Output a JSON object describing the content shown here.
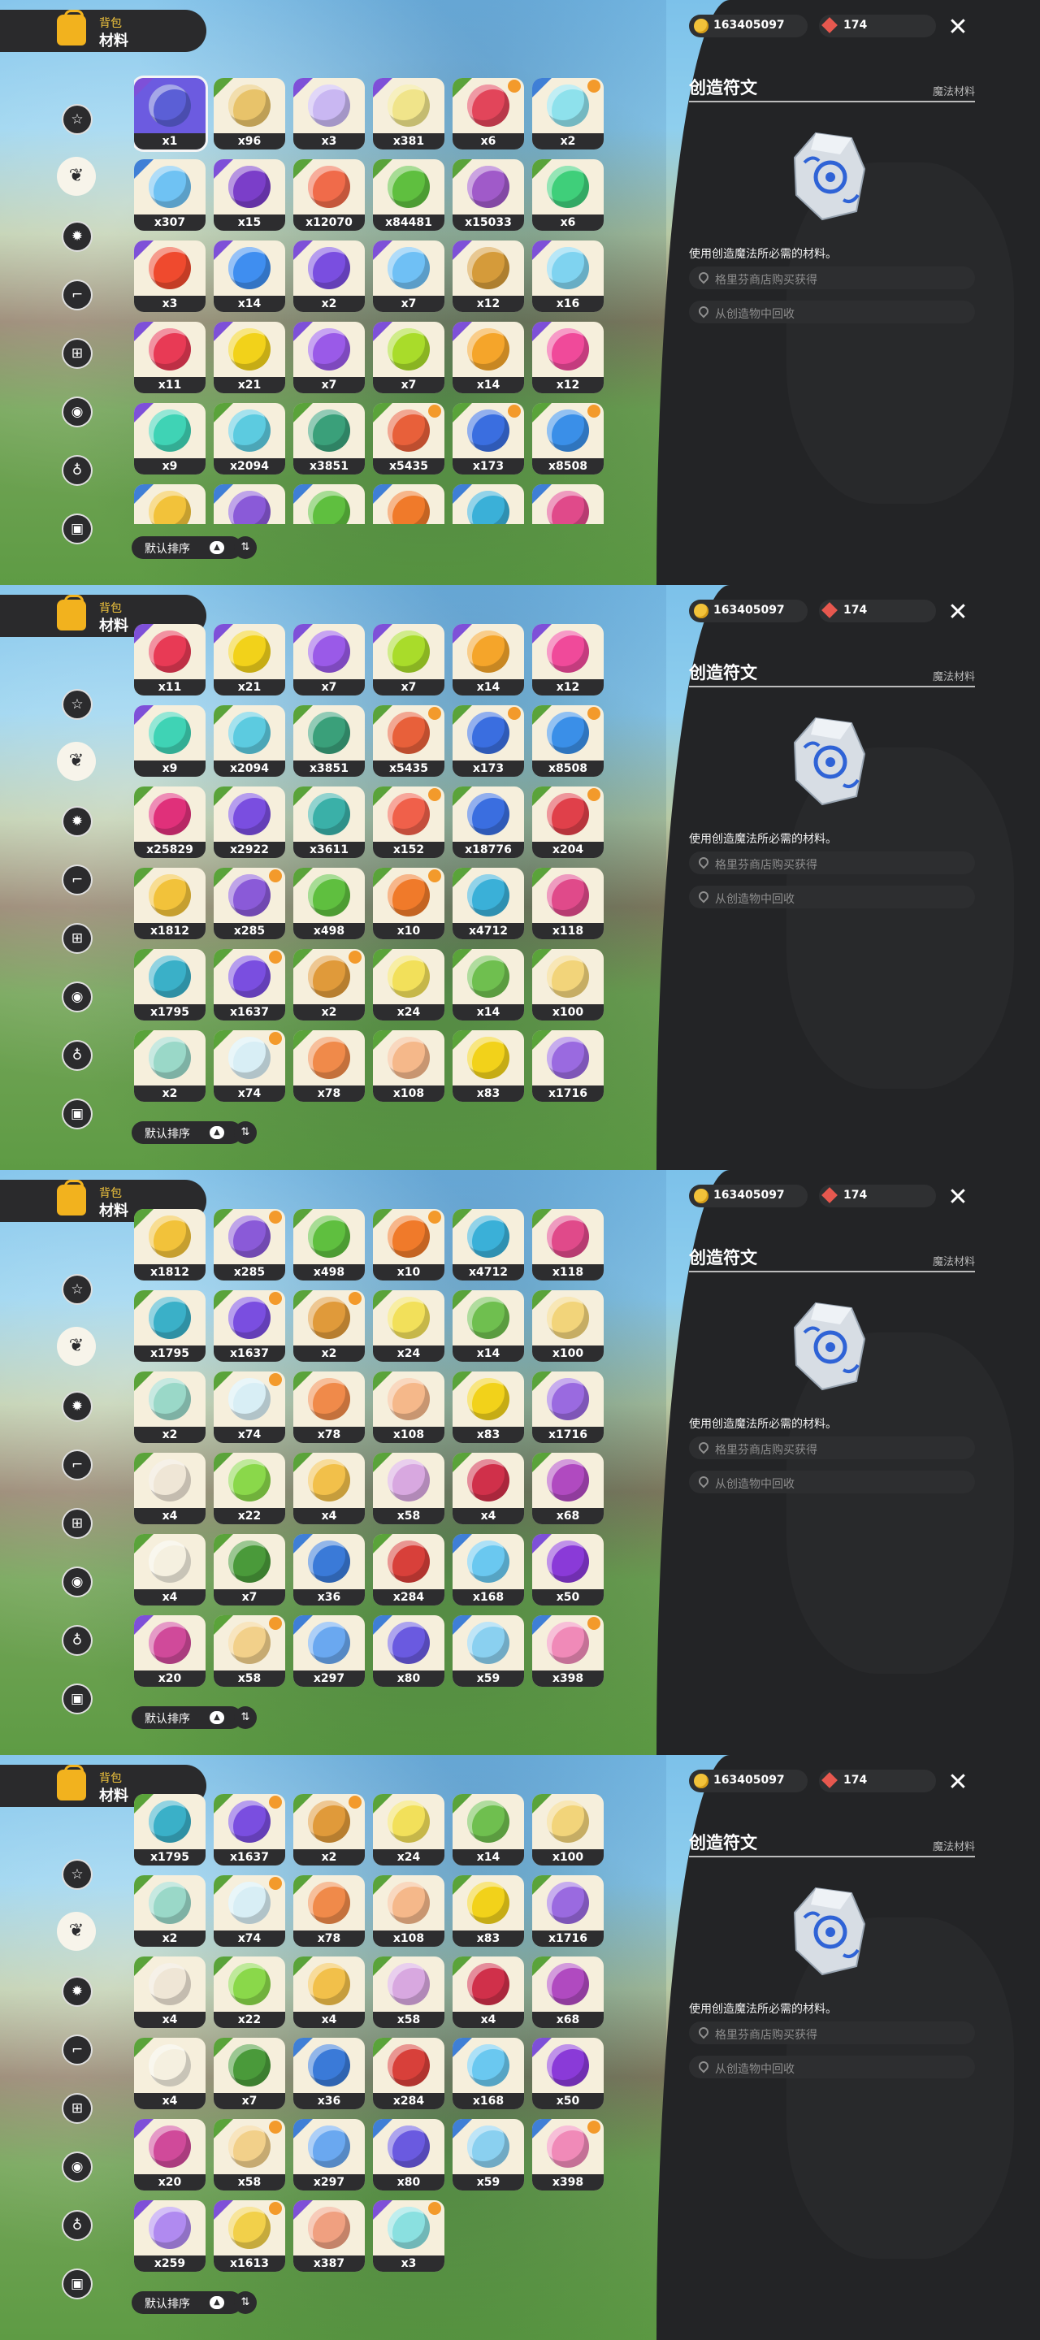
{
  "header": {
    "title_top": "背包",
    "title": "材料"
  },
  "currency": {
    "coins": "163405097",
    "gems": "174"
  },
  "sort": {
    "label": "默认排序"
  },
  "detail": {
    "item_name": "创造符文",
    "category": "魔法材料",
    "description": "使用创造魔法所必需的材料。",
    "sources": [
      "格里芬商店购买获得",
      "从创造物中回收"
    ]
  },
  "colors": {
    "accent": "#f2b21e",
    "panel_bg": "#232426",
    "rarity_purple": "#7e50d8",
    "rarity_green": "#5aa33a",
    "rarity_blue": "#3f7fd6"
  },
  "categories": [
    {
      "icon": "star-icon",
      "glyph": "☆"
    },
    {
      "icon": "leaf-icon",
      "glyph": "❦"
    },
    {
      "icon": "gear-icon",
      "glyph": "✹"
    },
    {
      "icon": "boot-icon",
      "glyph": "⌐"
    },
    {
      "icon": "cart-icon",
      "glyph": "⊞"
    },
    {
      "icon": "ball-icon",
      "glyph": "◉"
    },
    {
      "icon": "bell-icon",
      "glyph": "♁"
    },
    {
      "icon": "chest-icon",
      "glyph": "▣"
    }
  ],
  "views": [
    {
      "selected_category": 1,
      "rows": [
        [
          [
            "x1",
            "#5b5fd6",
            "p",
            0
          ],
          [
            "x96",
            "#e8c36a",
            "g",
            0
          ],
          [
            "x3",
            "#c9b7f2",
            "p",
            0
          ],
          [
            "x381",
            "#f0e48a",
            "p",
            0
          ],
          [
            "x6",
            "#e2455a",
            "g",
            1
          ],
          [
            "x2",
            "#8ee1ec",
            "b",
            1
          ]
        ],
        [
          [
            "x307",
            "#6fc2f3",
            "b",
            0
          ],
          [
            "x15",
            "#7b3ec9",
            "p",
            0
          ],
          [
            "x12070",
            "#f06b4a",
            "g",
            0
          ],
          [
            "x84481",
            "#5fbf3f",
            "g",
            0
          ],
          [
            "x15033",
            "#a05ac9",
            "g",
            0
          ],
          [
            "x6",
            "#3fcf7a",
            "g",
            0
          ]
        ],
        [
          [
            "x3",
            "#ef4a2e",
            "p",
            0
          ],
          [
            "x14",
            "#3f8ef0",
            "p",
            0
          ],
          [
            "x2",
            "#7a4ee0",
            "p",
            0
          ],
          [
            "x7",
            "#6fc0f5",
            "p",
            0
          ],
          [
            "x12",
            "#d59b3a",
            "p",
            0
          ],
          [
            "x16",
            "#7fd3f0",
            "p",
            0
          ]
        ],
        [
          [
            "x11",
            "#e83a55",
            "p",
            0
          ],
          [
            "x21",
            "#f2d21a",
            "p",
            0
          ],
          [
            "x7",
            "#9a5ae8",
            "p",
            0
          ],
          [
            "x7",
            "#a9dc2a",
            "p",
            0
          ],
          [
            "x14",
            "#f5a52a",
            "p",
            0
          ],
          [
            "x12",
            "#f04a9a",
            "p",
            0
          ]
        ],
        [
          [
            "x9",
            "#3fd3b5",
            "p",
            0
          ],
          [
            "x2094",
            "#5ccbe0",
            "g",
            0
          ],
          [
            "x3851",
            "#3aa07a",
            "g",
            0
          ],
          [
            "x5435",
            "#e8603a",
            "g",
            1
          ],
          [
            "x173",
            "#3a6ee0",
            "g",
            1
          ],
          [
            "x8508",
            "#3a8fe8",
            "g",
            1
          ]
        ],
        [
          [
            "",
            "#f2c23a",
            "b",
            0
          ],
          [
            "",
            "#8a5ad8",
            "b",
            0
          ],
          [
            "",
            "#5fbf3f",
            "b",
            0
          ],
          [
            "",
            "#f07a2a",
            "b",
            0
          ],
          [
            "",
            "#3ab0d8",
            "b",
            0
          ],
          [
            "",
            "#e04a8a",
            "b",
            0
          ]
        ]
      ]
    },
    {
      "selected_category": 1,
      "rows": [
        [
          [
            "x11",
            "#e83a55",
            "p",
            0
          ],
          [
            "x21",
            "#f2d21a",
            "p",
            0
          ],
          [
            "x7",
            "#9a5ae8",
            "p",
            0
          ],
          [
            "x7",
            "#a9dc2a",
            "p",
            0
          ],
          [
            "x14",
            "#f5a52a",
            "p",
            0
          ],
          [
            "x12",
            "#f04a9a",
            "p",
            0
          ]
        ],
        [
          [
            "x9",
            "#3fd3b5",
            "p",
            0
          ],
          [
            "x2094",
            "#5ccbe0",
            "g",
            0
          ],
          [
            "x3851",
            "#3aa07a",
            "g",
            0
          ],
          [
            "x5435",
            "#e8603a",
            "g",
            1
          ],
          [
            "x173",
            "#3a6ee0",
            "g",
            1
          ],
          [
            "x8508",
            "#3a8fe8",
            "g",
            1
          ]
        ],
        [
          [
            "x25829",
            "#e0307a",
            "g",
            0
          ],
          [
            "x2922",
            "#7a4ee0",
            "g",
            0
          ],
          [
            "x3611",
            "#3ab0a8",
            "g",
            0
          ],
          [
            "x152",
            "#f0604a",
            "g",
            1
          ],
          [
            "x18776",
            "#3a6ee0",
            "g",
            0
          ],
          [
            "x204",
            "#e0404a",
            "g",
            1
          ]
        ],
        [
          [
            "x1812",
            "#f2c23a",
            "g",
            0
          ],
          [
            "x285",
            "#8a5ad8",
            "g",
            1
          ],
          [
            "x498",
            "#5fbf3f",
            "g",
            0
          ],
          [
            "x10",
            "#f07a2a",
            "g",
            1
          ],
          [
            "x4712",
            "#3ab0d8",
            "g",
            0
          ],
          [
            "x118",
            "#e04a8a",
            "g",
            0
          ]
        ],
        [
          [
            "x1795",
            "#3ab0c8",
            "g",
            0
          ],
          [
            "x1637",
            "#7a4ee0",
            "g",
            1
          ],
          [
            "x2",
            "#e09a3a",
            "g",
            1
          ],
          [
            "x24",
            "#f2e05a",
            "g",
            0
          ],
          [
            "x14",
            "#6fbf4f",
            "g",
            0
          ],
          [
            "x100",
            "#f2d47a",
            "g",
            0
          ]
        ],
        [
          [
            "x2",
            "#9ad8c8",
            "g",
            0
          ],
          [
            "x74",
            "#d8eef5",
            "g",
            1
          ],
          [
            "x78",
            "#f08a4a",
            "g",
            0
          ],
          [
            "x108",
            "#f5b88a",
            "g",
            0
          ],
          [
            "x83",
            "#f2d21a",
            "g",
            0
          ],
          [
            "x1716",
            "#9a6ae0",
            "g",
            0
          ]
        ]
      ]
    },
    {
      "selected_category": 1,
      "rows": [
        [
          [
            "x1812",
            "#f2c23a",
            "g",
            0
          ],
          [
            "x285",
            "#8a5ad8",
            "g",
            1
          ],
          [
            "x498",
            "#5fbf3f",
            "g",
            0
          ],
          [
            "x10",
            "#f07a2a",
            "g",
            1
          ],
          [
            "x4712",
            "#3ab0d8",
            "g",
            0
          ],
          [
            "x118",
            "#e04a8a",
            "g",
            0
          ]
        ],
        [
          [
            "x1795",
            "#3ab0c8",
            "g",
            0
          ],
          [
            "x1637",
            "#7a4ee0",
            "g",
            1
          ],
          [
            "x2",
            "#e09a3a",
            "g",
            1
          ],
          [
            "x24",
            "#f2e05a",
            "g",
            0
          ],
          [
            "x14",
            "#6fbf4f",
            "g",
            0
          ],
          [
            "x100",
            "#f2d47a",
            "g",
            0
          ]
        ],
        [
          [
            "x2",
            "#9ad8c8",
            "g",
            0
          ],
          [
            "x74",
            "#d8eef5",
            "g",
            1
          ],
          [
            "x78",
            "#f08a4a",
            "g",
            0
          ],
          [
            "x108",
            "#f5b88a",
            "g",
            0
          ],
          [
            "x83",
            "#f2d21a",
            "g",
            0
          ],
          [
            "x1716",
            "#9a6ae0",
            "g",
            0
          ]
        ],
        [
          [
            "x4",
            "#efe6d6",
            "g",
            0
          ],
          [
            "x22",
            "#8ad84a",
            "g",
            0
          ],
          [
            "x4",
            "#f2c04a",
            "g",
            0
          ],
          [
            "x58",
            "#d8a8e0",
            "g",
            0
          ],
          [
            "x4",
            "#d0304a",
            "g",
            0
          ],
          [
            "x68",
            "#b04ac0",
            "g",
            0
          ]
        ],
        [
          [
            "x4",
            "#f5f0e0",
            "g",
            0
          ],
          [
            "x7",
            "#4a9a3a",
            "g",
            0
          ],
          [
            "x36",
            "#3a7ad8",
            "b",
            0
          ],
          [
            "x284",
            "#d8403a",
            "g",
            0
          ],
          [
            "x168",
            "#6ac8f0",
            "b",
            0
          ],
          [
            "x50",
            "#8a3ad8",
            "p",
            0
          ]
        ],
        [
          [
            "x20",
            "#d04a9a",
            "p",
            0
          ],
          [
            "x58",
            "#f2d08a",
            "g",
            1
          ],
          [
            "x297",
            "#6aa8f0",
            "b",
            0
          ],
          [
            "x80",
            "#6a5ae0",
            "b",
            0
          ],
          [
            "x59",
            "#8ad0f0",
            "b",
            0
          ],
          [
            "x398",
            "#f08ab8",
            "b",
            1
          ]
        ]
      ]
    },
    {
      "selected_category": 1,
      "rows": [
        [
          [
            "x1795",
            "#3ab0c8",
            "g",
            0
          ],
          [
            "x1637",
            "#7a4ee0",
            "g",
            1
          ],
          [
            "x2",
            "#e09a3a",
            "g",
            1
          ],
          [
            "x24",
            "#f2e05a",
            "g",
            0
          ],
          [
            "x14",
            "#6fbf4f",
            "g",
            0
          ],
          [
            "x100",
            "#f2d47a",
            "g",
            0
          ]
        ],
        [
          [
            "x2",
            "#9ad8c8",
            "g",
            0
          ],
          [
            "x74",
            "#d8eef5",
            "g",
            1
          ],
          [
            "x78",
            "#f08a4a",
            "g",
            0
          ],
          [
            "x108",
            "#f5b88a",
            "g",
            0
          ],
          [
            "x83",
            "#f2d21a",
            "g",
            0
          ],
          [
            "x1716",
            "#9a6ae0",
            "g",
            0
          ]
        ],
        [
          [
            "x4",
            "#efe6d6",
            "g",
            0
          ],
          [
            "x22",
            "#8ad84a",
            "g",
            0
          ],
          [
            "x4",
            "#f2c04a",
            "g",
            0
          ],
          [
            "x58",
            "#d8a8e0",
            "g",
            0
          ],
          [
            "x4",
            "#d0304a",
            "g",
            0
          ],
          [
            "x68",
            "#b04ac0",
            "g",
            0
          ]
        ],
        [
          [
            "x4",
            "#f5f0e0",
            "g",
            0
          ],
          [
            "x7",
            "#4a9a3a",
            "g",
            0
          ],
          [
            "x36",
            "#3a7ad8",
            "b",
            0
          ],
          [
            "x284",
            "#d8403a",
            "g",
            0
          ],
          [
            "x168",
            "#6ac8f0",
            "b",
            0
          ],
          [
            "x50",
            "#8a3ad8",
            "p",
            0
          ]
        ],
        [
          [
            "x20",
            "#d04a9a",
            "p",
            0
          ],
          [
            "x58",
            "#f2d08a",
            "g",
            1
          ],
          [
            "x297",
            "#6aa8f0",
            "b",
            0
          ],
          [
            "x80",
            "#6a5ae0",
            "b",
            0
          ],
          [
            "x59",
            "#8ad0f0",
            "b",
            0
          ],
          [
            "x398",
            "#f08ab8",
            "b",
            1
          ]
        ],
        [
          [
            "x259",
            "#b08af0",
            "p",
            0
          ],
          [
            "x1613",
            "#f2d04a",
            "p",
            1
          ],
          [
            "x387",
            "#f0a080",
            "p",
            0
          ],
          [
            "x3",
            "#8ae0e0",
            "p",
            1
          ]
        ]
      ]
    }
  ]
}
